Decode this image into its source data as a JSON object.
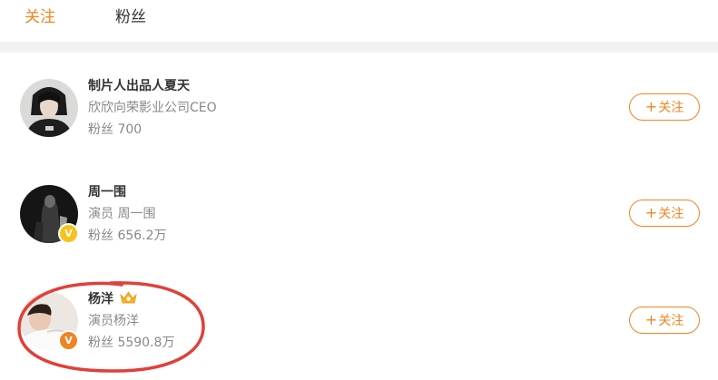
{
  "tabs": [
    {
      "label": "关注",
      "active": true
    },
    {
      "label": "粉丝",
      "active": false
    }
  ],
  "users": [
    {
      "name": "制片人出品人夏天",
      "desc": "欣欣向荣影业公司CEO",
      "fans_label": "粉丝",
      "fans": "700",
      "verified": false,
      "badge": "",
      "button": {
        "plus": "+",
        "label": "关注"
      }
    },
    {
      "name": "周一围",
      "desc": "演员 周一围",
      "fans_label": "粉丝",
      "fans": "656.2万",
      "verified": true,
      "badge": "yellow",
      "button": {
        "plus": "+",
        "label": "关注"
      }
    },
    {
      "name": "杨洋",
      "desc": "演员杨洋",
      "fans_label": "粉丝",
      "fans": "5590.8万",
      "verified": true,
      "badge": "orange",
      "crown": "crown-icon",
      "button": {
        "plus": "+",
        "label": "关注"
      }
    }
  ],
  "colors": {
    "accent": "#f5831f",
    "annotation": "#e0403a"
  }
}
